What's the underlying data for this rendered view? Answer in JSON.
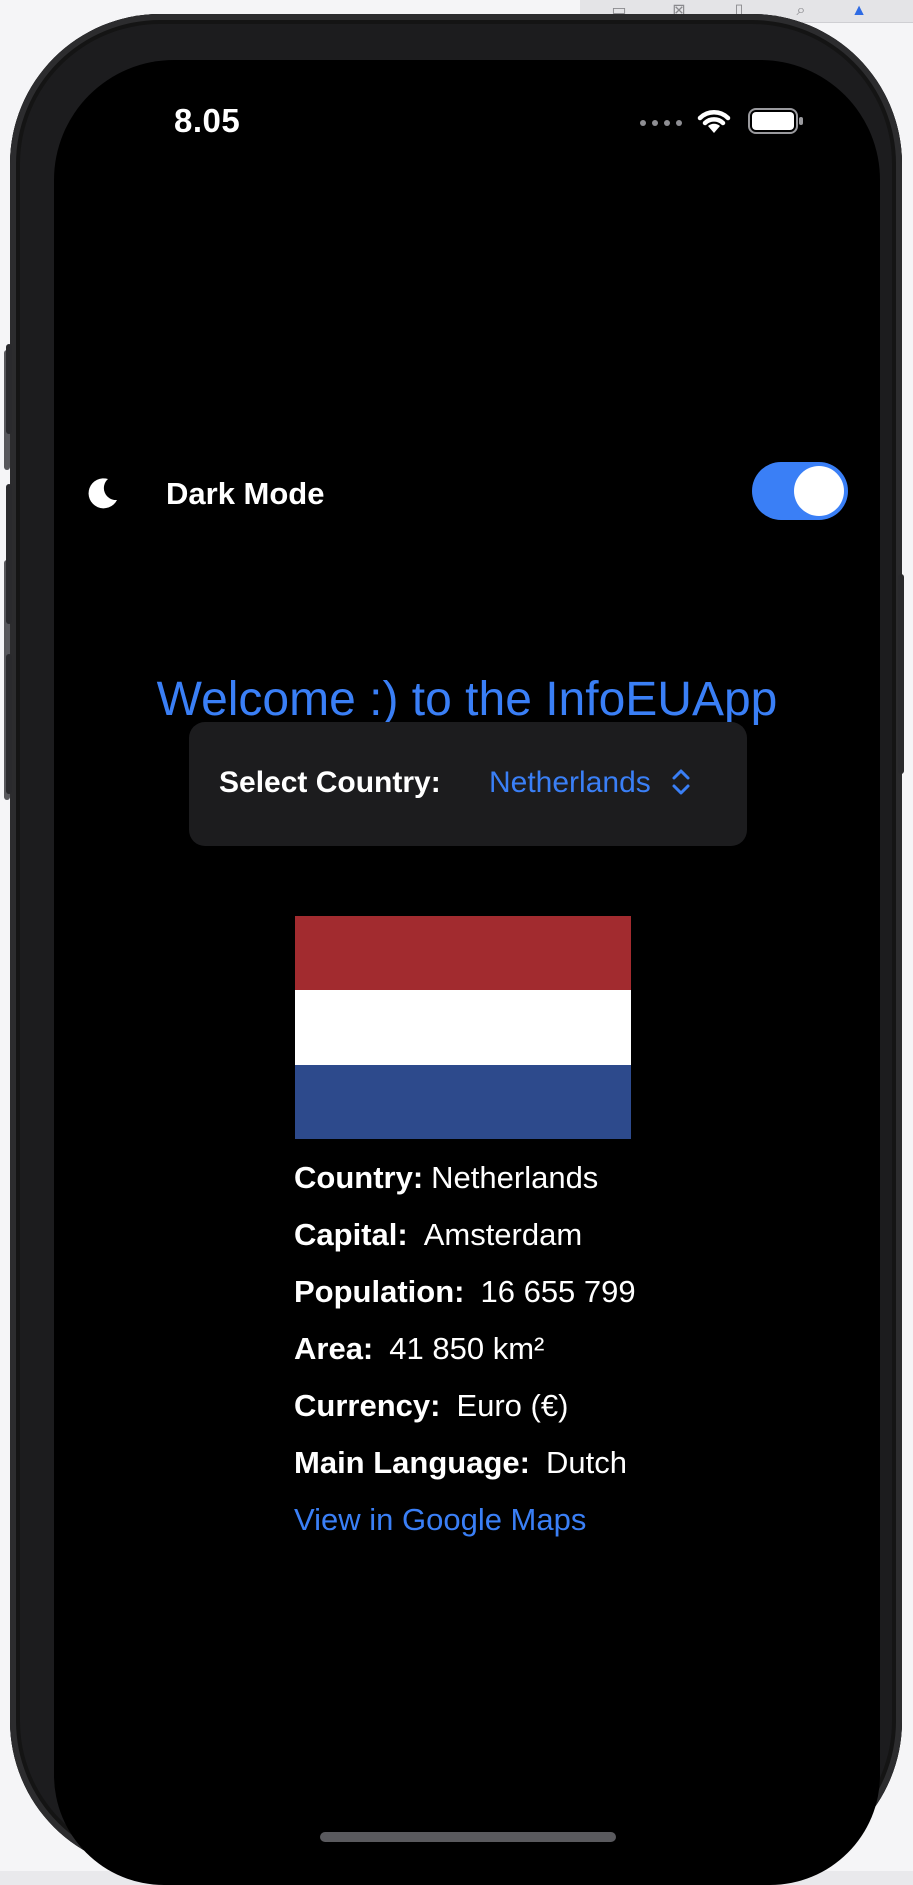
{
  "status_bar": {
    "time": "8.05"
  },
  "dark_mode": {
    "label": "Dark Mode",
    "enabled": true
  },
  "header": {
    "title": "Welcome :) to the InfoEUApp"
  },
  "picker": {
    "label": "Select Country:",
    "selected": "Netherlands"
  },
  "flag": {
    "colors": [
      "#a22b2f",
      "#ffffff",
      "#2d4a8c"
    ]
  },
  "info": {
    "country_key": "Country:",
    "country_value": "Netherlands",
    "capital_key": "Capital:",
    "capital_value": "Amsterdam",
    "population_key": "Population:",
    "population_value": "16 655 799",
    "area_key": "Area:",
    "area_value": "41 850 km²",
    "currency_key": "Currency:",
    "currency_value": "Euro (€)",
    "language_key": "Main Language:",
    "language_value": "Dutch",
    "maps_link": "View in Google Maps"
  },
  "colors": {
    "accent": "#3a7ff6",
    "background": "#000000",
    "card": "#1c1c1e"
  }
}
